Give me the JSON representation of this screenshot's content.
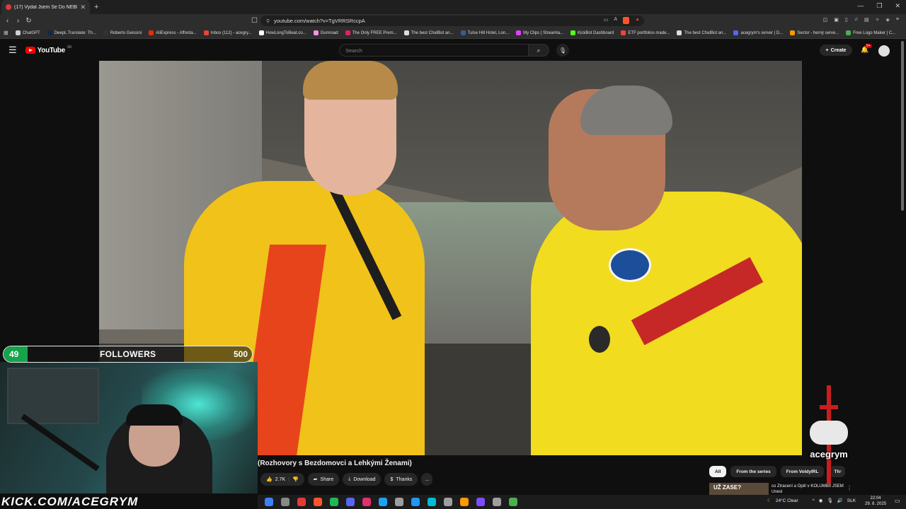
{
  "browser": {
    "tab_title": "(17) Vydal Jsem Se Do NEBEZ",
    "url": "youtube.com/watch?v=TgVRRSRccpA",
    "bookmarks": [
      {
        "label": "ChatGPT",
        "color": "#cfcfcf"
      },
      {
        "label": "DeepL Translate: Th...",
        "color": "#0f2b46"
      },
      {
        "label": "Roberto Geissini",
        "color": "#333333"
      },
      {
        "label": "AliExpress - Afforda...",
        "color": "#e62e04"
      },
      {
        "label": "Inbox (112) - acegry...",
        "color": "#ea4335"
      },
      {
        "label": "HowLongToBeat.co...",
        "color": "#ffffff"
      },
      {
        "label": "Gumroad",
        "color": "#ff90e8"
      },
      {
        "label": "The Only FREE Prem...",
        "color": "#e91e63"
      },
      {
        "label": "The best ChatBot an...",
        "color": "#dddddd"
      },
      {
        "label": "Tulse Hill Hotel, Lon...",
        "color": "#3b5998"
      },
      {
        "label": "My Clips | Streamla...",
        "color": "#e040fb"
      },
      {
        "label": "KickBot Dashboard",
        "color": "#53fc18"
      },
      {
        "label": "ETF portfolios made...",
        "color": "#f44336"
      },
      {
        "label": "The best ChatBot an...",
        "color": "#dddddd"
      },
      {
        "label": "acegrym's server | D...",
        "color": "#5865f2"
      },
      {
        "label": "Sector - herný serve...",
        "color": "#ff9800"
      },
      {
        "label": "Free Logo Maker | C...",
        "color": "#4caf50"
      }
    ]
  },
  "youtube": {
    "logo_text": "YouTube",
    "country": "SK",
    "search_placeholder": "Search",
    "create_label": "Create",
    "notif_count": "9+",
    "video_title": "(Rozhovory s Bezdomovci a Lehkými Ženami)",
    "likes": "2.7K",
    "share_label": "Share",
    "download_label": "Download",
    "thanks_label": "Thanks",
    "more_label": "...",
    "chips": [
      "All",
      "From the series",
      "From VoldyIRL",
      "Th"
    ],
    "rec_thumb_text": "UŽ ZASE?",
    "rec_title": "co Ztracení a Opilí v KOLUMBII JSEM Unesl",
    "rec_more": "⋮"
  },
  "stream_overlay": {
    "followers_current": "49",
    "followers_label": "FOLLOWERS",
    "followers_goal": "500",
    "followers_progress_fraction": 0.098,
    "kick_url": "KICK.COM/ACEGRYM",
    "brand_name": "acegrym"
  },
  "taskbar": {
    "weather": "24°C  Clear",
    "language": "SLK",
    "time": "22:04",
    "date": "29. 8. 2025",
    "app_icon_colors": [
      "#3b82f6",
      "#888888",
      "#e53935",
      "#fb542b",
      "#1db954",
      "#5865f2",
      "#e1306c",
      "#1da1f2",
      "#9e9e9e",
      "#2196f3",
      "#00bcd4",
      "#9e9e9e",
      "#ff9800",
      "#7c4dff",
      "#9e9e9e",
      "#4caf50"
    ]
  },
  "colors": {
    "youtube_red": "#ff0000",
    "follower_green": "#16a34a"
  }
}
